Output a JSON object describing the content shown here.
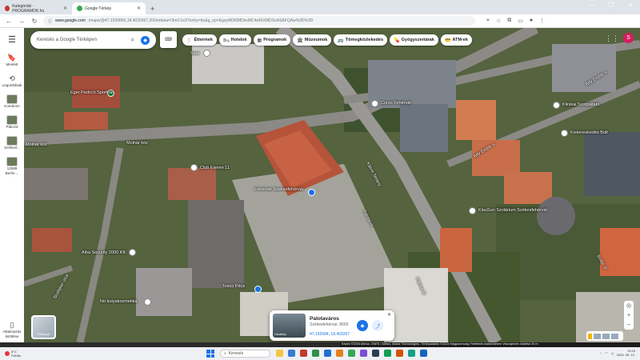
{
  "browser": {
    "tabs": [
      {
        "title": "Kategóriák · PROGRAMOK.hu",
        "active": false,
        "favicon_color": "#c0392b"
      },
      {
        "title": "Google Térkép",
        "active": true,
        "favicon_color": "#34a853"
      }
    ],
    "new_tab": "+",
    "url_host": "www.google.com",
    "url_rest": "/maps/@47.1929866,18.4032667,200m/data=!3m1!1e3?entry=ttu&g_ep=EgoyMDI0MDkxMC4wIKXMDSoASAFQAw%3D%3D",
    "window_controls": [
      "—",
      "❐",
      "✕"
    ]
  },
  "rail": {
    "menu": "☰",
    "items": [
      {
        "icon": "🔖",
        "label": "Mentett"
      },
      {
        "icon": "⟲",
        "label": "Legutóbbiak"
      },
      {
        "label": "Komárom"
      },
      {
        "label": "Pákozd"
      },
      {
        "label": "Székesf..."
      },
      {
        "label": "12589 Berlin-..."
      }
    ],
    "bottom_label": "Alkalmazás letöltése"
  },
  "search": {
    "placeholder": "Keresés a Google Térképen",
    "search_icon": "⌕",
    "directions_icon": "◆"
  },
  "chips": [
    {
      "icon": "🍴",
      "label": "Éttermek"
    },
    {
      "icon": "🛏",
      "label": "Hotelek"
    },
    {
      "icon": "▦",
      "label": "Programok"
    },
    {
      "icon": "🏛",
      "label": "Múzeumok"
    },
    {
      "icon": "🚌",
      "label": "Tömegközlekedés"
    },
    {
      "icon": "💊",
      "label": "Gyógyszertárak"
    },
    {
      "icon": "💳",
      "label": "ATM-ek"
    }
  ],
  "avatar": "S",
  "map_labels": [
    {
      "name": "spar",
      "text": "Spar"
    },
    {
      "name": "eger-pedro",
      "text": "Eger Pedro's Sportbar"
    },
    {
      "name": "molnar-koz-1",
      "text": "Molnár köz"
    },
    {
      "name": "molnar-koz-2",
      "text": "Molnár köz"
    },
    {
      "name": "club-eleven",
      "text": "Club Eleven 11"
    },
    {
      "name": "fehervar",
      "text": "Fehérvár Székesfehérvár"
    },
    {
      "name": "corso",
      "text": "Corso Fehérvár"
    },
    {
      "name": "kalvin",
      "text": "Kálvin Sétány"
    },
    {
      "name": "alba-security",
      "text": "Alba Security 2000 Kft."
    },
    {
      "name": "tesco",
      "text": "Tesco Pécs"
    },
    {
      "name": "no-kutyai",
      "text": "No kutyakozmetika"
    },
    {
      "name": "ady-endre-1",
      "text": "Ady Endre u."
    },
    {
      "name": "ady-endre-2",
      "text": "Ady Endre u."
    },
    {
      "name": "klinikai",
      "text": "Klinikai Szolgáltató"
    },
    {
      "name": "kiskereskedes",
      "text": "Kiskereskedés Bolt"
    },
    {
      "name": "sun-szolarium",
      "text": "KleuSun Szolárium Székesfehérvár"
    },
    {
      "name": "palotai-ut-1",
      "text": "Palotai út"
    },
    {
      "name": "palotai-ut-2",
      "text": "Palotai út"
    },
    {
      "name": "budai-ut",
      "text": "Budai út"
    },
    {
      "name": "bodajker",
      "text": "Bodajker utca"
    }
  ],
  "layers": {
    "label": "Rétegek"
  },
  "card": {
    "title": "Palotaváros",
    "address": "Székesfehérvár, 8000",
    "coords": "47.192684, 18.403267",
    "streetview": "Utcakép",
    "dir_icon": "◆",
    "share_icon": "⤴",
    "close": "✕"
  },
  "controls": {
    "locate": "◎",
    "zoom_in": "+",
    "zoom_out": "−"
  },
  "attribution": "Képek ©2024 Airbus, CNES / Airbus, Maxar Technologies, Térképadatok ©2024   Magyarország   Feltételek   Adatvédelem   Visszajelzés küldése   20 m",
  "taskbar": {
    "weather_temp": "8°C",
    "weather_desc": "Felhős",
    "search_placeholder": "Keresés",
    "clock_time": "13:15",
    "clock_date": "2024. 09. 12."
  }
}
